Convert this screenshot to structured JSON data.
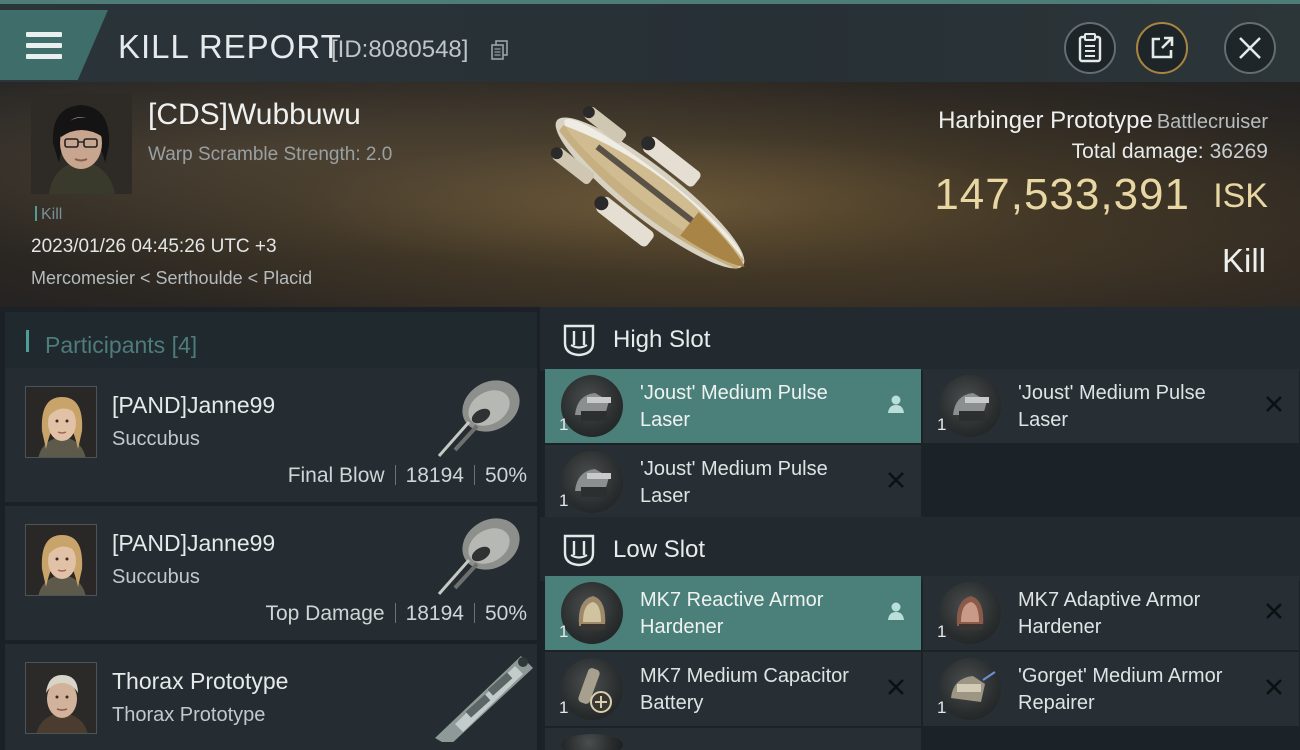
{
  "header": {
    "title": "KILL REPORT",
    "report_id": "[ID:8080548]"
  },
  "victim": {
    "name": "[CDS]Wubbuwu",
    "scramble_strength": "Warp Scramble Strength: 2.0",
    "kill_tag": "Kill",
    "timestamp": "2023/01/26 04:45:26 UTC +3",
    "location": "Mercomesier < Serthoulde < Placid",
    "ship_name": "Harbinger Prototype",
    "ship_class": "Battlecruiser",
    "total_damage_label": "Total damage:",
    "total_damage_value": "36269",
    "isk_value": "147,533,391",
    "isk_unit": "ISK",
    "result": "Kill"
  },
  "participants": {
    "title": "Participants",
    "count": "[4]",
    "rows": [
      {
        "name": "[PAND]Janne99",
        "ship": "Succubus",
        "role": "Final Blow",
        "damage": "18194",
        "percent": "50%"
      },
      {
        "name": "[PAND]Janne99",
        "ship": "Succubus",
        "role": "Top Damage",
        "damage": "18194",
        "percent": "50%"
      },
      {
        "name": "Thorax Prototype",
        "ship": "Thorax Prototype"
      }
    ]
  },
  "fitting": {
    "high_slot": {
      "title": "High Slot",
      "modules": [
        {
          "qty": "1",
          "name": "'Joust' Medium Pulse Laser",
          "state": "active"
        },
        {
          "qty": "1",
          "name": "'Joust' Medium Pulse Laser",
          "state": "destroyed"
        },
        {
          "qty": "1",
          "name": "'Joust' Medium Pulse Laser",
          "state": "destroyed"
        }
      ]
    },
    "low_slot": {
      "title": "Low Slot",
      "modules": [
        {
          "qty": "1",
          "name": "MK7 Reactive Armor Hardener",
          "state": "active"
        },
        {
          "qty": "1",
          "name": "MK7 Adaptive Armor Hardener",
          "state": "destroyed"
        },
        {
          "qty": "1",
          "name": "MK7 Medium Capacitor Battery",
          "state": "destroyed"
        },
        {
          "qty": "1",
          "name": "'Gorget' Medium Armor Repairer",
          "state": "destroyed"
        }
      ]
    }
  },
  "colors": {
    "accent": "#4b7f79",
    "isk_gold": "#e9d7a3",
    "header_border": "#4e7d78"
  }
}
